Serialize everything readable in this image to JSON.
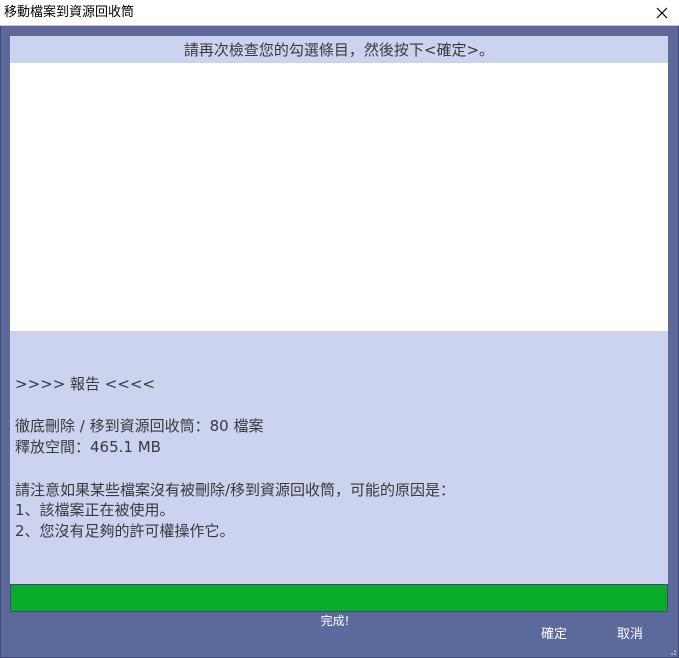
{
  "window": {
    "title": "移動檔案到資源回收筒",
    "close_icon": "close-icon"
  },
  "instruction": "請再次檢查您的勾選條目，然後按下<確定>。",
  "report": {
    "header": ">>>> 報告 <<<<",
    "deleted": "徹底刪除 / 移到資源回收筒：80 檔案",
    "freed": "釋放空間：465.1 MB",
    "note": "請注意如果某些檔案沒有被刪除/移到資源回收筒，可能的原因是：",
    "reason1": "1、該檔案正在被使用。",
    "reason2": "2、您沒有足夠的許可權操作它。"
  },
  "progress": {
    "value": 1.0,
    "color": "#07ad28",
    "status": "完成!"
  },
  "buttons": {
    "ok": "確定",
    "cancel": "取消"
  },
  "colors": {
    "background": "#5b6a9a",
    "panel": "#cbd3ef"
  }
}
